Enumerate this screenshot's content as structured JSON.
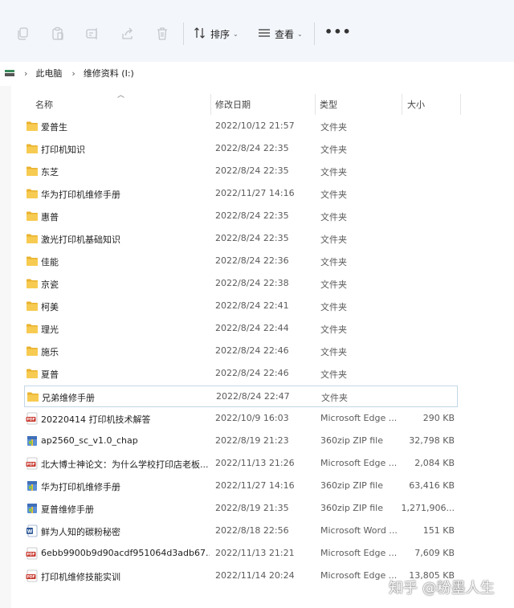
{
  "toolbar": {
    "sort_label": "排序",
    "view_label": "查看",
    "more_label": "•••",
    "icons": [
      "copy-icon",
      "paste-icon",
      "rename-icon",
      "share-icon",
      "delete-icon",
      "sort-icon",
      "view-icon",
      "more-icon"
    ]
  },
  "address": {
    "crumbs": [
      "此电脑",
      "维修资料 (I:)"
    ]
  },
  "columns": {
    "name": "名称",
    "date": "修改日期",
    "type": "类型",
    "size": "大小"
  },
  "rows": [
    {
      "name": "爱普生",
      "date": "2022/10/12 21:57",
      "type": "文件夹",
      "size": "",
      "icon": "folder-icon"
    },
    {
      "name": "打印机知识",
      "date": "2022/8/24 22:35",
      "type": "文件夹",
      "size": "",
      "icon": "folder-icon"
    },
    {
      "name": "东芝",
      "date": "2022/8/24 22:35",
      "type": "文件夹",
      "size": "",
      "icon": "folder-icon"
    },
    {
      "name": "华为打印机维修手册",
      "date": "2022/11/27 14:16",
      "type": "文件夹",
      "size": "",
      "icon": "folder-icon"
    },
    {
      "name": "惠普",
      "date": "2022/8/24 22:35",
      "type": "文件夹",
      "size": "",
      "icon": "folder-icon"
    },
    {
      "name": "激光打印机基础知识",
      "date": "2022/8/24 22:35",
      "type": "文件夹",
      "size": "",
      "icon": "folder-icon"
    },
    {
      "name": "佳能",
      "date": "2022/8/24 22:36",
      "type": "文件夹",
      "size": "",
      "icon": "folder-icon"
    },
    {
      "name": "京瓷",
      "date": "2022/8/24 22:38",
      "type": "文件夹",
      "size": "",
      "icon": "folder-icon"
    },
    {
      "name": "柯美",
      "date": "2022/8/24 22:41",
      "type": "文件夹",
      "size": "",
      "icon": "folder-icon"
    },
    {
      "name": "理光",
      "date": "2022/8/24 22:44",
      "type": "文件夹",
      "size": "",
      "icon": "folder-icon"
    },
    {
      "name": "施乐",
      "date": "2022/8/24 22:46",
      "type": "文件夹",
      "size": "",
      "icon": "folder-icon"
    },
    {
      "name": "夏普",
      "date": "2022/8/24 22:46",
      "type": "文件夹",
      "size": "",
      "icon": "folder-icon"
    },
    {
      "name": "兄弟维修手册",
      "date": "2022/8/24 22:47",
      "type": "文件夹",
      "size": "",
      "icon": "folder-icon",
      "selected": true
    },
    {
      "name": "20220414 打印机技术解答",
      "date": "2022/10/9 16:03",
      "type": "Microsoft Edge ...",
      "size": "290 KB",
      "icon": "pdf-icon"
    },
    {
      "name": "ap2560_sc_v1.0_chap",
      "date": "2022/8/19 21:23",
      "type": "360zip ZIP file",
      "size": "32,798 KB",
      "icon": "zip-icon"
    },
    {
      "name": "北大博士神论文：为什么学校打印店老板...",
      "date": "2022/11/13 21:26",
      "type": "Microsoft Edge ...",
      "size": "2,084 KB",
      "icon": "pdf-icon"
    },
    {
      "name": "华为打印机维修手册",
      "date": "2022/11/27 14:16",
      "type": "360zip ZIP file",
      "size": "63,416 KB",
      "icon": "zip-icon"
    },
    {
      "name": "夏普维修手册",
      "date": "2022/8/19 21:35",
      "type": "360zip ZIP file",
      "size": "1,271,906...",
      "icon": "zip-icon"
    },
    {
      "name": "鲜为人知的碳粉秘密",
      "date": "2022/8/18 22:56",
      "type": "Microsoft Word ...",
      "size": "151 KB",
      "icon": "word-icon"
    },
    {
      "name": "6ebb9900b9d90acdf951064d3adb67...",
      "date": "2022/11/13 21:21",
      "type": "Microsoft Edge ...",
      "size": "7,609 KB",
      "icon": "pdf-icon"
    },
    {
      "name": "打印机维修技能实训",
      "date": "2022/11/14 20:24",
      "type": "Microsoft Edge ...",
      "size": "13,805 KB",
      "icon": "pdf-icon"
    }
  ],
  "watermark": "知乎 @粉墨人生",
  "colors": {
    "toolbar_bg": "#f3f6fb",
    "folder": "#f3c03f",
    "pdf": "#c8372d",
    "selected_border": "#c3d7e6"
  }
}
